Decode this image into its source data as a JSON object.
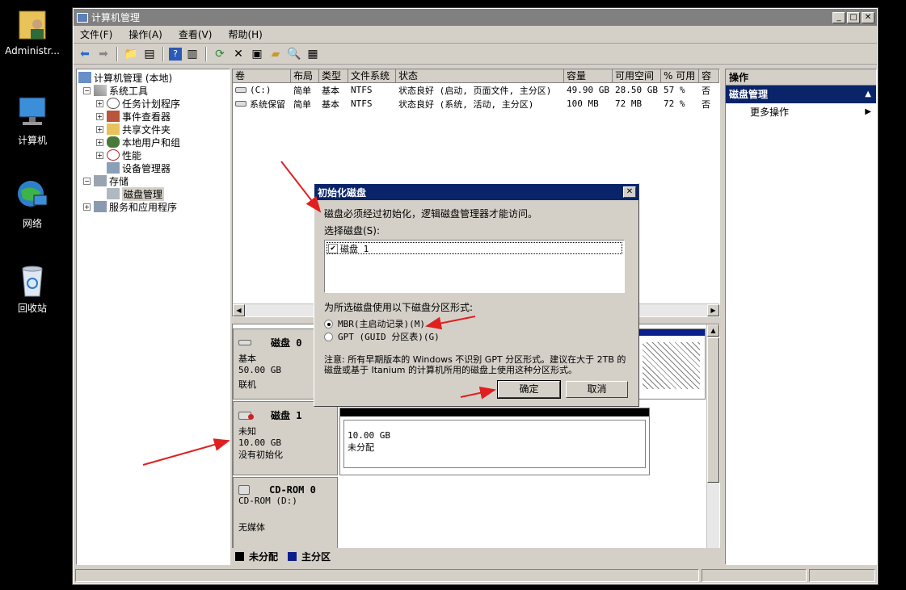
{
  "desktop": {
    "icons": [
      {
        "label": "Administr..."
      },
      {
        "label": "计算机"
      },
      {
        "label": "网络"
      },
      {
        "label": "回收站"
      }
    ]
  },
  "window": {
    "title": "计算机管理",
    "menus": [
      "文件(F)",
      "操作(A)",
      "查看(V)",
      "帮助(H)"
    ],
    "tree": [
      {
        "label": "计算机管理 (本地)"
      },
      {
        "label": "系统工具"
      },
      {
        "label": "任务计划程序"
      },
      {
        "label": "事件查看器"
      },
      {
        "label": "共享文件夹"
      },
      {
        "label": "本地用户和组"
      },
      {
        "label": "性能"
      },
      {
        "label": "设备管理器"
      },
      {
        "label": "存储"
      },
      {
        "label": "磁盘管理"
      },
      {
        "label": "服务和应用程序"
      }
    ],
    "volume_columns": [
      "卷",
      "布局",
      "类型",
      "文件系统",
      "状态",
      "容量",
      "可用空间",
      "% 可用",
      "容"
    ],
    "volumes": [
      {
        "vol": "(C:)",
        "layout": "简单",
        "type": "基本",
        "fs": "NTFS",
        "status": "状态良好 (启动, 页面文件, 主分区)",
        "cap": "49.90 GB",
        "free": "28.50 GB",
        "pct": "57 %",
        "ft": "否"
      },
      {
        "vol": "系统保留",
        "layout": "简单",
        "type": "基本",
        "fs": "NTFS",
        "status": "状态良好 (系统, 活动, 主分区)",
        "cap": "100 MB",
        "free": "72 MB",
        "pct": "72 %",
        "ft": "否"
      }
    ],
    "disks": [
      {
        "name": "磁盘 0",
        "kind": "基本",
        "size": "50.00 GB",
        "state": "联机"
      },
      {
        "name": "磁盘 1",
        "kind": "未知",
        "size": "10.00 GB",
        "state": "没有初始化",
        "part_size": "10.00 GB",
        "part_state": "未分配"
      },
      {
        "name": "CD-ROM 0",
        "kind": "CD-ROM (D:)",
        "state": "无媒体"
      }
    ],
    "legend": [
      {
        "label": "未分配",
        "color": "#000000"
      },
      {
        "label": "主分区",
        "color": "#0a1e8c"
      }
    ],
    "actions": {
      "header": "操作",
      "selected": "磁盘管理",
      "more": "更多操作"
    }
  },
  "dialog": {
    "title": "初始化磁盘",
    "intro": "磁盘必须经过初始化，逻辑磁盘管理器才能访问。",
    "select_label": "选择磁盘(S):",
    "disk_item": "磁盘 1",
    "style_label": "为所选磁盘使用以下磁盘分区形式:",
    "mbr": "MBR(主启动记录)(M)",
    "gpt": "GPT (GUID 分区表)(G)",
    "note": "注意: 所有早期版本的 Windows 不识别 GPT 分区形式。建议在大于 2TB 的磁盘或基于 Itanium 的计算机所用的磁盘上使用这种分区形式。",
    "ok": "确定",
    "cancel": "取消"
  },
  "colors": {
    "title_active": "#0a246a",
    "window_face": "#d4d0c8",
    "arrow": "#e02020"
  }
}
